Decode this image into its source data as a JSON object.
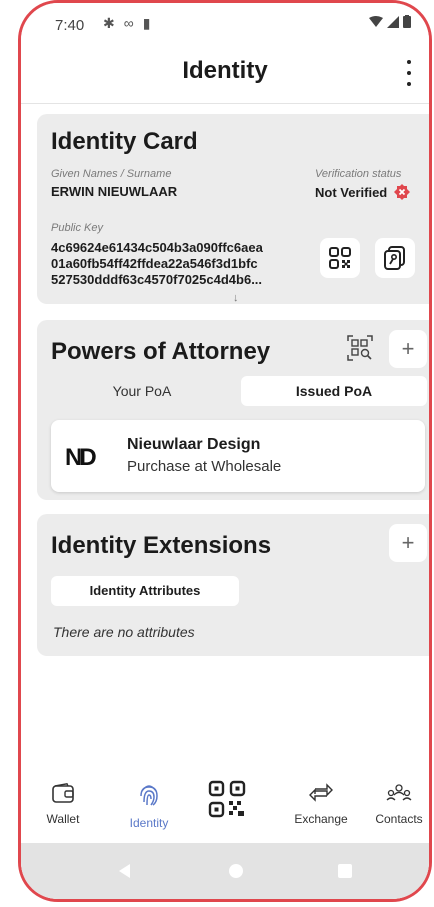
{
  "status": {
    "time": "7:40"
  },
  "appbar": {
    "title": "Identity"
  },
  "identity_card": {
    "title": "Identity Card",
    "names_label": "Given Names / Surname",
    "name": "ERWIN NIEUWLAAR",
    "verification_label": "Verification status",
    "verification_value": "Not Verified",
    "public_key_label": "Public Key",
    "public_key_lines": [
      "4c69624e61434c504b3a090ffc6aea",
      "01a60fb54ff42ffdea22a546f3d1bfc",
      "527530dddf63c4570f7025c4d4b6..."
    ],
    "expand_arrow": "↓"
  },
  "poa": {
    "title": "Powers of Attorney",
    "add_label": "+",
    "tabs": [
      "Your PoA",
      "Issued PoA"
    ],
    "active_tab": "Issued PoA",
    "items": [
      {
        "logo": "ND",
        "name": "Nieuwlaar Design",
        "description": "Purchase at Wholesale"
      }
    ]
  },
  "extensions": {
    "title": "Identity Extensions",
    "add_label": "+",
    "chip": "Identity Attributes",
    "empty_text": "There are no attributes"
  },
  "nav": {
    "items": [
      {
        "label": "Wallet",
        "icon": "wallet-icon"
      },
      {
        "label": "Identity",
        "icon": "fingerprint-icon"
      },
      {
        "label": "",
        "icon": "qr-scan-icon"
      },
      {
        "label": "Exchange",
        "icon": "exchange-icon"
      },
      {
        "label": "Contacts",
        "icon": "contacts-icon"
      }
    ],
    "active": "Identity"
  },
  "colors": {
    "accent": "#5a78c8",
    "error": "#e0474d",
    "card_bg": "#ececec",
    "frame": "#e0474d"
  }
}
